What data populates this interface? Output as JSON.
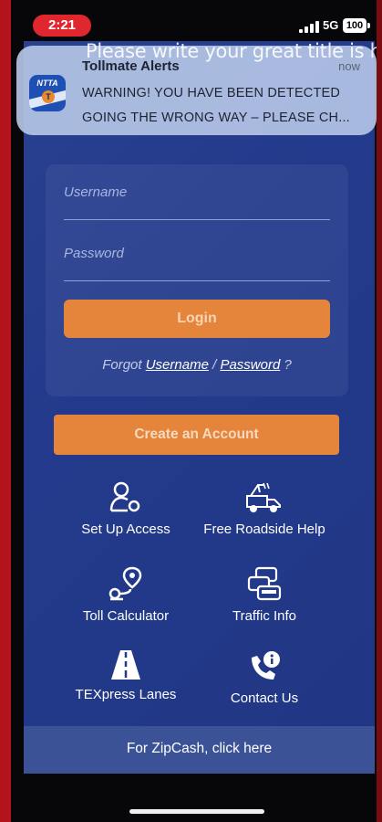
{
  "status_bar": {
    "time": "2:21",
    "network": "5G",
    "battery": "100"
  },
  "notification": {
    "app_name": "Tollmate Alerts",
    "time": "now",
    "message_line1": "WARNING! YOU HAVE BEEN DETECTED",
    "message_line2": "GOING THE WRONG WAY – PLEASE CH...",
    "icon_text": "NTTA",
    "icon_badge": "T"
  },
  "overlay_title": "Please write your great title is h",
  "login": {
    "username_label": "Username",
    "password_label": "Password",
    "login_button": "Login",
    "forgot_prefix": "Forgot",
    "forgot_username": "Username",
    "forgot_sep": "/",
    "forgot_password": "Password",
    "forgot_suffix": "?"
  },
  "create_account": "Create an Account",
  "tiles": {
    "setup_access": "Set Up Access",
    "roadside_help": "Free Roadside Help",
    "toll_calculator": "Toll Calculator",
    "traffic_info": "Traffic Info",
    "texpress_lanes": "TEXpress Lanes",
    "contact_us": "Contact Us"
  },
  "zipcash": "For ZipCash, click here",
  "colors": {
    "background": "#233a8c",
    "accent_orange": "#e5853b",
    "zipcash_bar": "#3b5296",
    "time_pill": "#e0262e"
  }
}
